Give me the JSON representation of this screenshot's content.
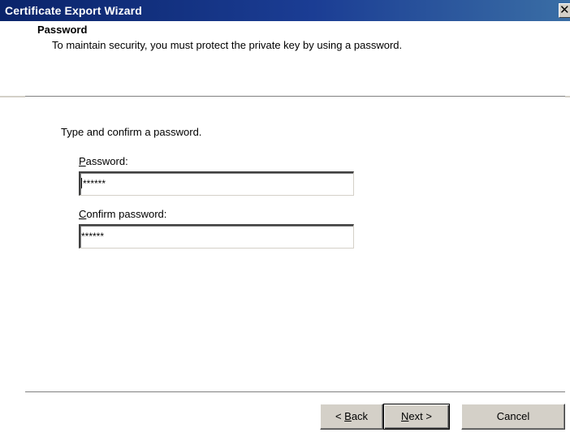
{
  "window": {
    "title": "Certificate Export Wizard",
    "close_glyph": "✕"
  },
  "header": {
    "title": "Password",
    "subtitle": "To maintain security, you must protect the private key by using a password."
  },
  "body": {
    "instruction": "Type and confirm a password.",
    "password": {
      "label_mnemonic": "P",
      "label_rest": "assword:",
      "value": "******"
    },
    "confirm": {
      "label_mnemonic": "C",
      "label_rest": "onfirm password:",
      "value": "******"
    }
  },
  "buttons": {
    "back_prefix": "< ",
    "back_mnemonic": "B",
    "back_rest": "ack",
    "next_mnemonic": "N",
    "next_rest": "ext >",
    "cancel": "Cancel"
  },
  "colors": {
    "title_bar": "#0a246a",
    "dialog_face": "#d4d0c8",
    "content_bg": "#ffffff"
  }
}
